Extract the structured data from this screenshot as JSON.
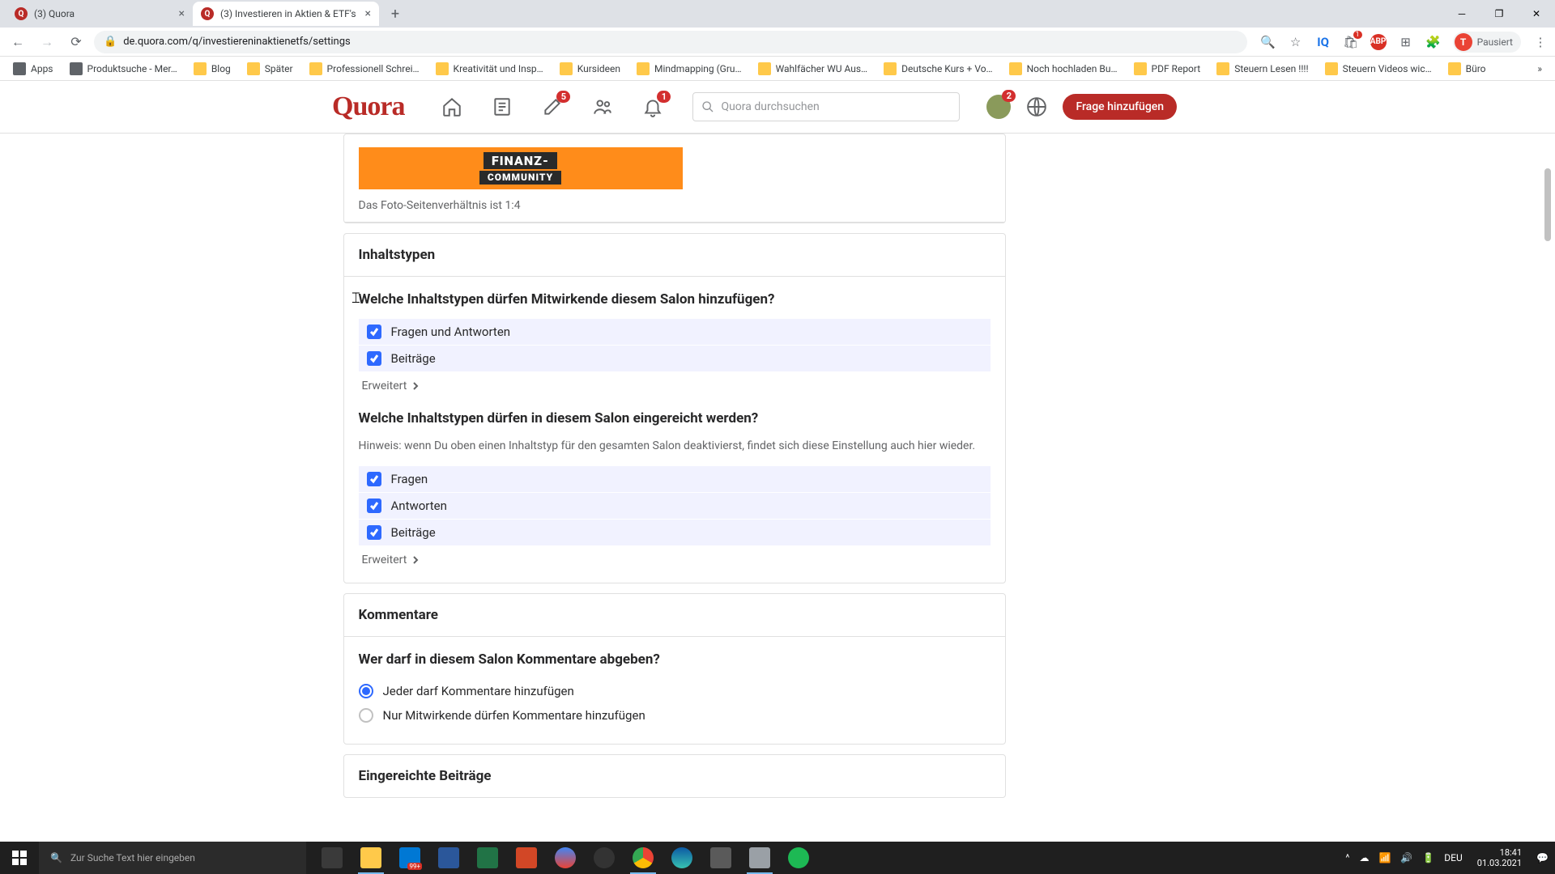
{
  "browser": {
    "tabs": [
      {
        "title": "(3) Quora",
        "active": false
      },
      {
        "title": "(3) Investieren in Aktien & ETF's",
        "active": true
      }
    ],
    "url": "de.quora.com/q/investiereninaktienetfs/settings",
    "profile_label": "Pausiert",
    "bookmarks": [
      "Apps",
      "Produktsuche - Mer…",
      "Blog",
      "Später",
      "Professionell Schrei…",
      "Kreativität und Insp…",
      "Kursideen",
      "Mindmapping (Gru…",
      "Wahlfächer WU Aus…",
      "Deutsche Kurs + Vo…",
      "Noch hochladen Bu…",
      "PDF Report",
      "Steuern Lesen !!!!",
      "Steuern Videos wic…",
      "Büro"
    ]
  },
  "quora": {
    "logo": "Quora",
    "search_placeholder": "Quora durchsuchen",
    "badges": {
      "edit": "5",
      "bell": "1",
      "avatar": "2"
    },
    "add_question": "Frage hinzufügen"
  },
  "banner": {
    "line1": "FINANZ-",
    "line2": "COMMUNITY",
    "caption": "Das Foto-Seitenverhältnis ist 1:4"
  },
  "sections": {
    "content_types_title": "Inhaltstypen",
    "q1": "Welche Inhaltstypen dürfen Mitwirkende diesem Salon hinzufügen?",
    "q1_options": {
      "qa": "Fragen und Antworten",
      "posts": "Beiträge"
    },
    "expand": "Erweitert",
    "q2": "Welche Inhaltstypen dürfen in diesem Salon eingereicht werden?",
    "q2_hint": "Hinweis: wenn Du oben einen Inhaltstyp für den gesamten Salon deaktivierst, findet sich diese Einstellung auch hier wieder.",
    "q2_options": {
      "questions": "Fragen",
      "answers": "Antworten",
      "posts": "Beiträge"
    },
    "comments_title": "Kommentare",
    "q3": "Wer darf in diesem Salon Kommentare abgeben?",
    "q3_options": {
      "everyone": "Jeder darf Kommentare hinzufügen",
      "contributors": "Nur Mitwirkende dürfen Kommentare hinzufügen"
    },
    "submitted_title": "Eingereichte Beiträge"
  },
  "taskbar": {
    "search_placeholder": "Zur Suche Text hier eingeben",
    "lang": "DEU",
    "time": "18:41",
    "date": "01.03.2021",
    "inbox_count": "99+"
  }
}
